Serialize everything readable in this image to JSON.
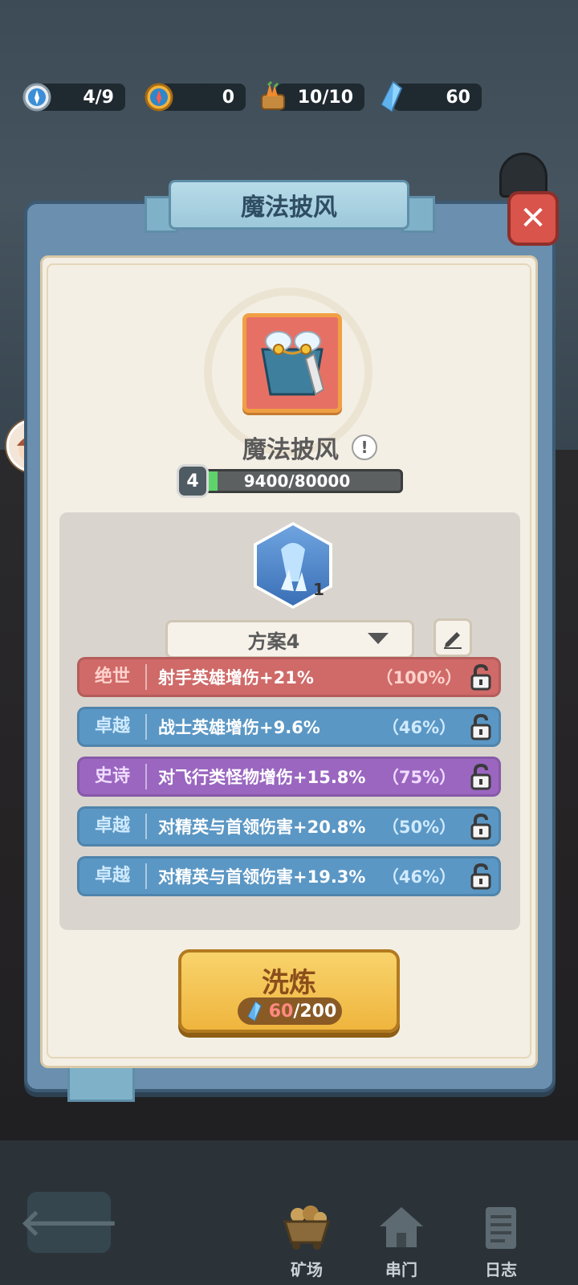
{
  "resources": [
    {
      "icon": "compass-blue-icon",
      "value": "4/9"
    },
    {
      "icon": "compass-gold-icon",
      "value": "0"
    },
    {
      "icon": "carrot-basket-icon",
      "value": "10/10"
    },
    {
      "icon": "crystal-icon",
      "value": "60"
    }
  ],
  "panel": {
    "title": "魔法披风",
    "item_name": "魔法披风",
    "level": "4",
    "xp_text": "9400/80000",
    "xp_progress": 0.1175,
    "skill_count": "1",
    "plan_label": "方案4",
    "stats": [
      {
        "tier": "绝世",
        "text": "射手英雄增伤+21%",
        "pct": "（100%）",
        "color": "#cf6a68",
        "tier_color": "#ffd1cc",
        "pct_color": "#ffd1cc"
      },
      {
        "tier": "卓越",
        "text": "战士英雄增伤+9.6%",
        "pct": "（46%）",
        "color": "#5b97c4",
        "tier_color": "#cfeafd",
        "pct_color": "#cfeafd"
      },
      {
        "tier": "史诗",
        "text": "对飞行类怪物增伤+15.8%",
        "pct": "（75%）",
        "color": "#9a66c0",
        "tier_color": "#f0ddff",
        "pct_color": "#f0ddff"
      },
      {
        "tier": "卓越",
        "text": "对精英与首领伤害+20.8%",
        "pct": "（50%）",
        "color": "#5b97c4",
        "tier_color": "#cfeafd",
        "pct_color": "#cfeafd"
      },
      {
        "tier": "卓越",
        "text": "对精英与首领伤害+19.3%",
        "pct": "（46%）",
        "color": "#5b97c4",
        "tier_color": "#cfeafd",
        "pct_color": "#cfeafd"
      }
    ],
    "wash": {
      "label": "洗炼",
      "cost_current": "60",
      "cost_sep": "/",
      "cost_max": "200"
    }
  },
  "nav": {
    "back_icon": "arrow-left-icon",
    "items": [
      {
        "label": "矿场",
        "icon": "mine-cart-icon"
      },
      {
        "label": "串门",
        "icon": "house-icon"
      },
      {
        "label": "日志",
        "icon": "log-icon"
      }
    ]
  }
}
